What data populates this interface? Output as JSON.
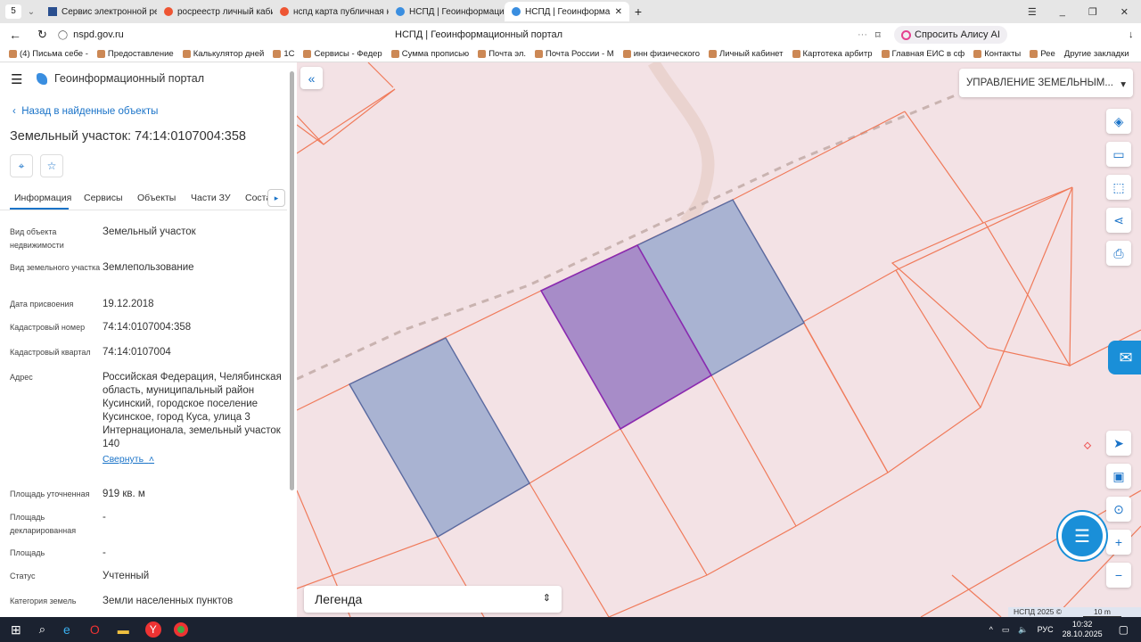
{
  "browser": {
    "tab_count": "5",
    "tabs": [
      {
        "label": "Сервис электронной регистрации"
      },
      {
        "label": "росреестр личный кабинет"
      },
      {
        "label": "нспд карта публичная кадастровая"
      },
      {
        "label": "НСПД | Геоинформационный"
      },
      {
        "label": "НСПД | Геоинформационный",
        "active": true
      }
    ],
    "url": "nspd.gov.ru",
    "page_title": "НСПД | Геоинформационный портал",
    "alice_label": "Спросить Алису AI",
    "bookmarks": [
      "(4) Письма себе -",
      "Предоставление",
      "Калькулятор дней",
      "1С",
      "Сервисы - Федер",
      "Сумма прописью",
      "Почта эл.",
      "Почта России - М",
      "инн физического",
      "",
      "Личный кабинет",
      "Картотека арбитр",
      "Главная ЕИС в сф",
      "Контакты",
      "Рее"
    ],
    "other_bookmarks": "Другие закладки"
  },
  "panel": {
    "app_title": "Геоинформационный портал",
    "back_link": "Назад в найденные объекты",
    "object_title": "Земельный участок: 74:14:0107004:358",
    "tabs": [
      "Информация",
      "Сервисы",
      "Объекты",
      "Части ЗУ",
      "Соста"
    ],
    "fields": [
      {
        "label": "Вид объекта недвижимости",
        "value": "Земельный участок"
      },
      {
        "label": "Вид земельного участка",
        "value": "Землепользование"
      },
      {
        "label": "Дата присвоения",
        "value": "19.12.2018"
      },
      {
        "label": "Кадастровый номер",
        "value": "74:14:0107004:358"
      },
      {
        "label": "Кадастровый квартал",
        "value": "74:14:0107004"
      },
      {
        "label": "Адрес",
        "value": "Российская Федерация, Челябинская область, муниципальный район Кусинский, городское поселение Кусинское, город Куса, улица 3 Интернационала, земельный участок 140"
      },
      {
        "label": "Площадь уточненная",
        "value": "919 кв. м"
      },
      {
        "label": "Площадь декларированная",
        "value": "-"
      },
      {
        "label": "Площадь",
        "value": "-"
      },
      {
        "label": "Статус",
        "value": "Учтенный"
      },
      {
        "label": "Категория земель",
        "value": "Земли населенных пунктов"
      }
    ],
    "collapse_link": "Свернуть"
  },
  "map": {
    "layer_select": "УПРАВЛЕНИЕ ЗЕМЕЛЬНЫМ...",
    "legend": "Легенда",
    "copyright": "НСПД 2025 ©",
    "scale": "10 m",
    "colors": {
      "selected": "#a78cc8",
      "neighbor": "#a9b3d2",
      "boundary": "#f07a5a"
    }
  },
  "taskbar": {
    "lang": "РУС",
    "time": "10:32",
    "date": "28.10.2025"
  }
}
